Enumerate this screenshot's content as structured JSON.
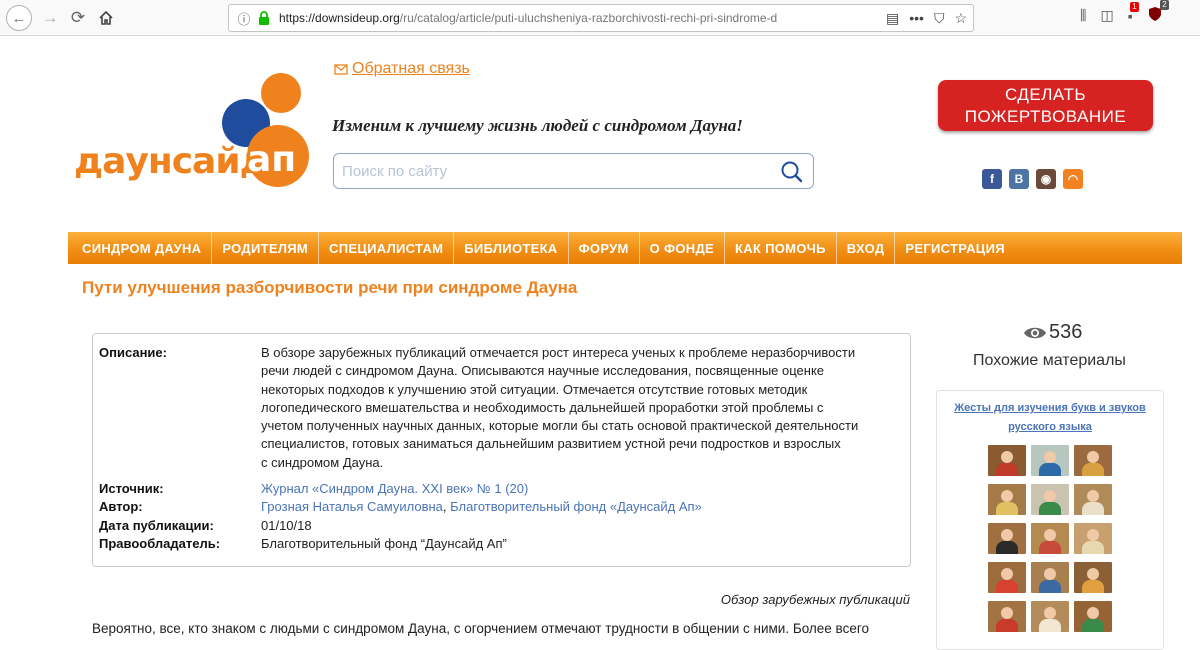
{
  "browser": {
    "url_host": "https://downsideup.org",
    "url_path": "/ru/catalog/article/puti-uluchsheniya-razborchivosti-rechi-pri-sindrome-d",
    "extension_badge_1": "1",
    "extension_badge_2": "2"
  },
  "header": {
    "logo_word": "даунсайд",
    "logo_ap": "ап",
    "feedback_label": "Обратная связь",
    "slogan": "Изменим к лучшему жизнь людей с синдромом Дауна!",
    "search_placeholder": "Поиск по сайту",
    "donate_line1": "СДЕЛАТЬ",
    "donate_line2": "ПОЖЕРТВОВАНИЕ",
    "social": [
      {
        "name": "facebook",
        "glyph": "f",
        "color": "#3b5998"
      },
      {
        "name": "vkontakte",
        "glyph": "B",
        "color": "#4c75a3"
      },
      {
        "name": "instagram",
        "glyph": "◉",
        "color": "#6b4a3a"
      },
      {
        "name": "rss",
        "glyph": "◠",
        "color": "#f58220"
      }
    ]
  },
  "nav": {
    "items": [
      "СИНДРОМ ДАУНА",
      "РОДИТЕЛЯМ",
      "СПЕЦИАЛИСТАМ",
      "БИБЛИОТЕКА",
      "ФОРУМ",
      "О ФОНДЕ",
      "КАК ПОМОЧЬ",
      "ВХОД",
      "РЕГИСТРАЦИЯ"
    ]
  },
  "article": {
    "title": "Пути улучшения разборчивости речи при синдроме Дауна",
    "labels": {
      "description": "Описание:",
      "source": "Источник:",
      "author": "Автор:",
      "date": "Дата публикации:",
      "rights": "Правообладатель:"
    },
    "description_lines": [
      "В обзоре зарубежных публикаций отмечается рост интереса ученых к проблеме неразборчивости",
      "речи людей с синдромом Дауна. Описываются научные исследования, посвященные оценке",
      "некоторых подходов к улучшению этой ситуации. Отмечается отсутствие готовых методик",
      "логопедического вмешательства и необходимость дальнейшей проработки этой проблемы с",
      "учетом полученных научных данных, которые могли бы стать основой практической деятельности",
      "специалистов, готовых заниматься дальнейшим развитием устной речи подростков и взрослых",
      "с синдромом Дауна."
    ],
    "source": "Журнал «Синдром Дауна. XXI век» № 1 (20)",
    "author_1": "Грозная Наталья Самуиловна",
    "author_sep": ", ",
    "author_2": "Благотворительный фонд «Даунсайд Ап»",
    "date": "01/10/18",
    "rights": "Благотворительный фонд “Даунсайд Ап”",
    "review_note": "Обзор зарубежных публикаций",
    "body_start": "Вероятно, все, кто знаком с людьми с синдромом Дауна, с огорчением отмечают трудности в общении с ними. Более всего"
  },
  "sidebar": {
    "views": "536",
    "similar_title": "Похожие материалы",
    "similar_link": "Жесты для изучения букв и звуков русского языка"
  }
}
